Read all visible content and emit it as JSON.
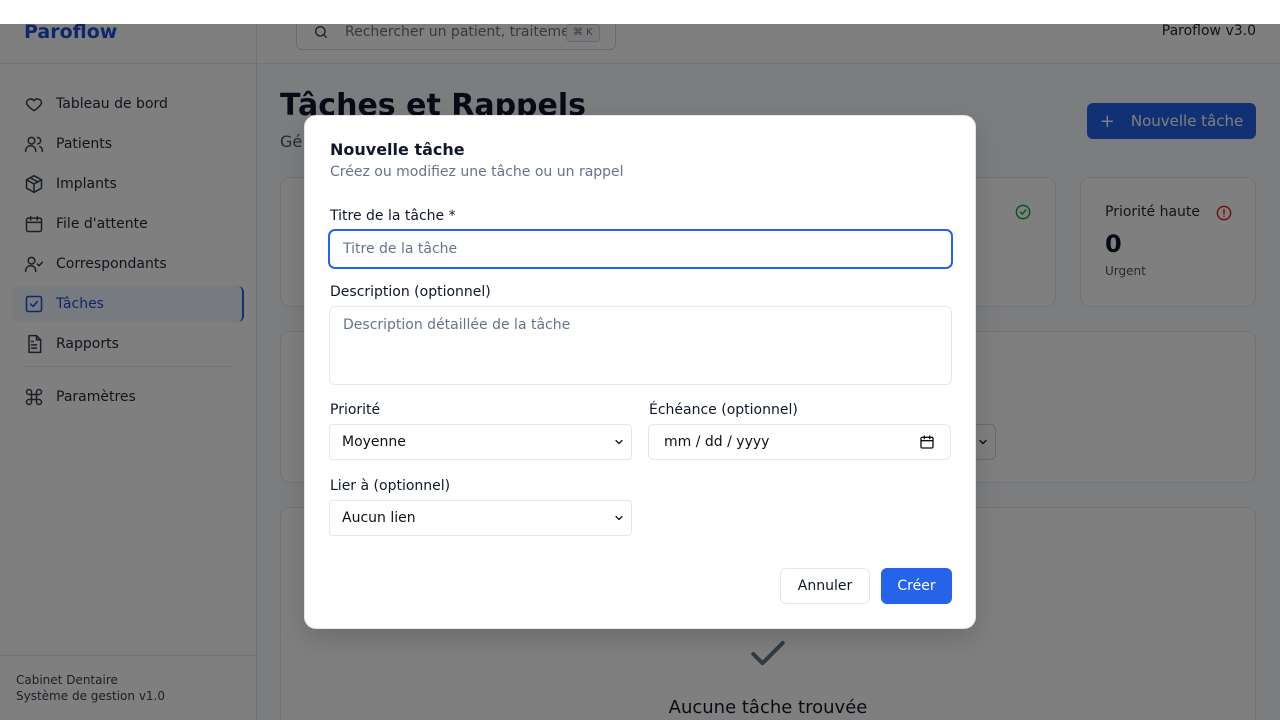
{
  "app": {
    "brand": "Paroflow",
    "version": "Paroflow v3.0"
  },
  "search": {
    "placeholder": "Rechercher un patient, traitement...",
    "shortcut": "⌘ K"
  },
  "sidebar": {
    "items": [
      {
        "label": "Tableau de bord",
        "icon": "heart-icon",
        "active": false
      },
      {
        "label": "Patients",
        "icon": "users-icon",
        "active": false
      },
      {
        "label": "Implants",
        "icon": "package-icon",
        "active": false
      },
      {
        "label": "File d'attente",
        "icon": "calendar-icon",
        "active": false
      },
      {
        "label": "Correspondants",
        "icon": "user-check-icon",
        "active": false
      },
      {
        "label": "Tâches",
        "icon": "checkbox-icon",
        "active": true
      },
      {
        "label": "Rapports",
        "icon": "document-icon",
        "active": false
      }
    ],
    "settings": {
      "label": "Paramètres",
      "icon": "command-icon"
    },
    "footer": {
      "line1": "Cabinet Dentaire",
      "line2": "Système de gestion v1.0"
    }
  },
  "page": {
    "title": "Tâches et Rappels",
    "subtitle": "Gé",
    "new_task_label": "Nouvelle tâche",
    "stats": {
      "high_priority": {
        "label": "Priorité haute",
        "value": "0",
        "note": "Urgent"
      }
    },
    "empty_state": "Aucune tâche trouvée"
  },
  "modal": {
    "title": "Nouvelle tâche",
    "subtitle": "Créez ou modifiez une tâche ou un rappel",
    "title_label": "Titre de la tâche *",
    "title_placeholder": "Titre de la tâche",
    "description_label": "Description (optionnel)",
    "description_placeholder": "Description détaillée de la tâche",
    "priority_label": "Priorité",
    "priority_value": "Moyenne",
    "due_label": "Échéance (optionnel)",
    "due_placeholder": "mm / dd / yyyy",
    "link_label": "Lier à (optionnel)",
    "link_value": "Aucun lien",
    "cancel_label": "Annuler",
    "create_label": "Créer"
  },
  "colors": {
    "accent": "#2563eb",
    "brand": "#1d4ed8",
    "danger": "#dc2626",
    "success": "#16a34a"
  }
}
